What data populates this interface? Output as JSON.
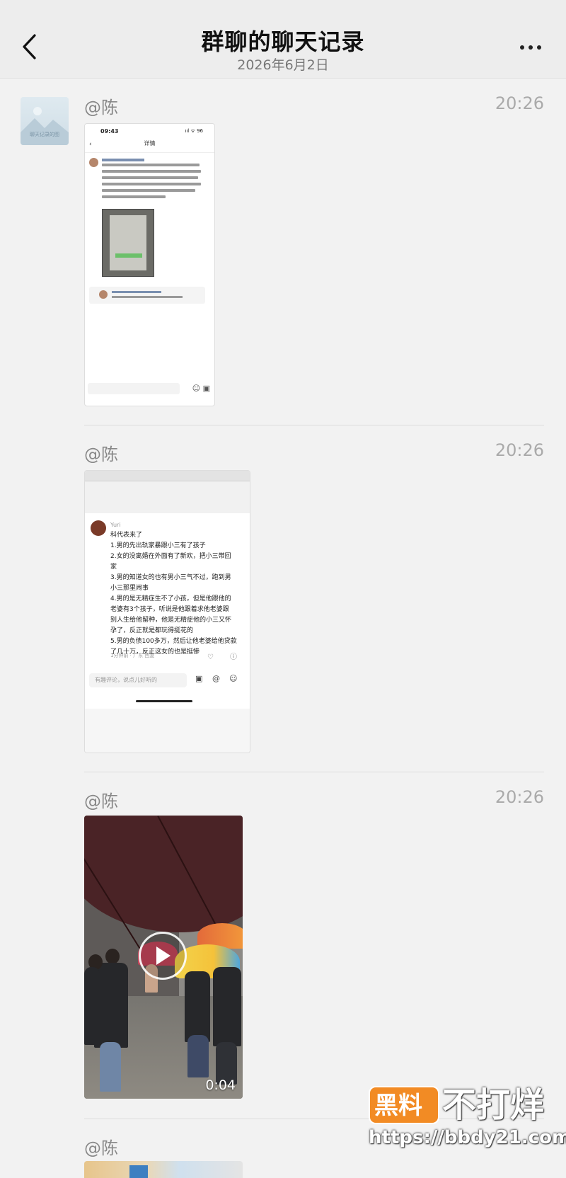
{
  "header": {
    "title": "群聊的聊天记录",
    "subtitle": "2026年6月2日",
    "back_icon": "chevron-left-icon",
    "more_icon": "more-dots-icon"
  },
  "chat_avatar": {
    "caption": "聊天记录的图"
  },
  "messages": [
    {
      "sender": "@陈",
      "time": "20:26",
      "type": "image"
    },
    {
      "sender": "@陈",
      "time": "20:26",
      "type": "image"
    },
    {
      "sender": "@陈",
      "time": "20:26",
      "type": "video",
      "duration": "0:04"
    },
    {
      "sender": "@陈",
      "type": "image"
    }
  ],
  "shot1": {
    "status_time": "09:43",
    "status_right": "ııl ᯤ 96",
    "header": "详情"
  },
  "shot2": {
    "user": "Yuri",
    "text_lines": [
      "科代表来了",
      "1.男的先出轨家暴跟小三有了孩子",
      "2.女的没离婚在外面有了新欢，把小三带回",
      "家",
      "3.男的知道女的也有男小三气不过，跑到男",
      "小三那里闹事",
      "4.男的是无精症生不了小孩，但是他跟他的",
      "老婆有3个孩子，听说是他跟着求他老婆跟",
      "别人生给他留种，他是无精症他的小三又怀",
      "孕了，反正就是都玩得挺花的",
      "5.男的负债100多万，然后让他老婆给他贷款",
      "了几十万，反正这女的也是挺惨"
    ],
    "meta": "1分钟前 · 广东  回复",
    "input_placeholder": "有趣评论，说点儿好听的"
  },
  "watermark": {
    "logo": "黑料",
    "text": "不打烊",
    "url": "https://bbdy21.com"
  }
}
